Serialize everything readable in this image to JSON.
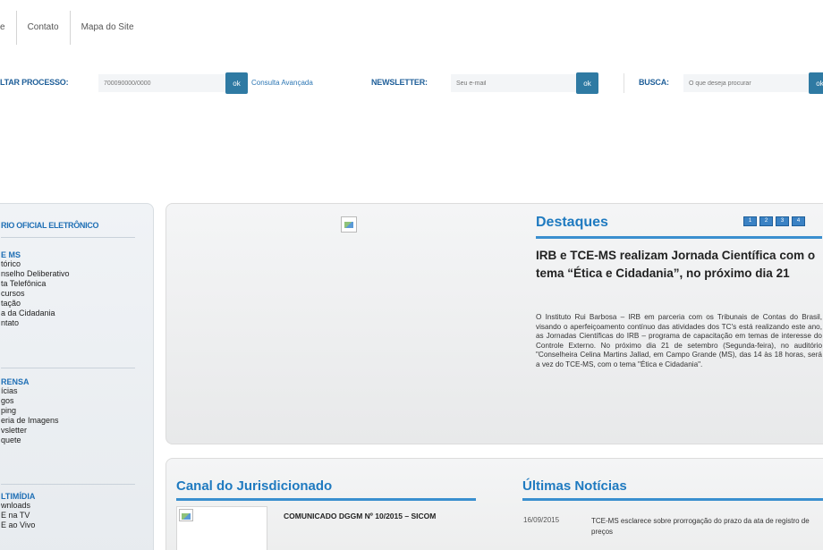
{
  "top_links": [
    "e",
    "Contato",
    "Mapa do Site"
  ],
  "search_bar": {
    "processo_label": "LTAR PROCESSO:",
    "processo_placeholder": "700090000/0000",
    "ok_label": "ok",
    "consulta_avancada": "Consulta Avançada",
    "newsletter_label": "NEWSLETTER:",
    "newsletter_placeholder": "Seu e-mail",
    "busca_label": "BUSCA:",
    "busca_placeholder": "O que deseja procurar"
  },
  "sidebar": {
    "diario": "RIO OFICIAL ELETRÔNICO",
    "sections": [
      {
        "title": "E MS",
        "items": [
          "tórico",
          "nselho Deliberativo",
          "ta Telefônica",
          "cursos",
          "tação",
          "a da Cidadania",
          "ntato"
        ]
      },
      {
        "title": "RENSA",
        "items": [
          "ícias",
          "gos",
          "ping",
          "eria de Imagens",
          "vsletter",
          "quete"
        ]
      },
      {
        "title": "LTIMÍDIA",
        "items": [
          "wnloads",
          "E na TV",
          "E ao Vivo"
        ]
      }
    ]
  },
  "destaques": {
    "title": "Destaques",
    "pager": [
      "1",
      "2",
      "3",
      "4"
    ],
    "headline": "IRB e TCE-MS realizam Jornada Científica com o tema “Ética e Cidadania”, no próximo dia 21",
    "body": "O Instituto Rui Barbosa – IRB em parceria com os Tribunais de Contas do Brasil, visando o aperfeiçoamento contínuo das atividades dos TC's está realizando este ano, as Jornadas Científicas do IRB – programa de capacitação em temas de interesse do Controle Externo. No próximo dia 21 de setembro (Segunda-feira), no auditório \"Conselheira Celina Martins Jallad, em Campo Grande (MS), das 14 às 18 horas, será a vez do TCE-MS, com o tema \"Ética e Cidadania\"."
  },
  "canal": {
    "title": "Canal do Jurisdicionado",
    "comunicado": "COMUNICADO DGGM Nº 10/2015 – SICOM"
  },
  "ultimas": {
    "title": "Últimas Notícias",
    "date": "16/09/2015",
    "text": "TCE-MS esclarece sobre prorrogação do prazo da ata de registro de preços"
  }
}
